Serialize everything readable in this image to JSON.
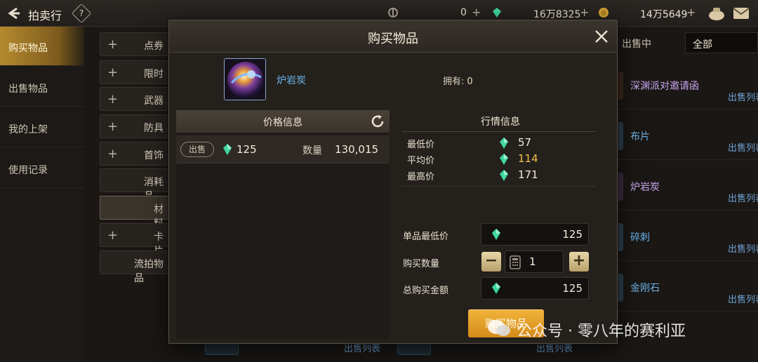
{
  "topbar": {
    "title": "拍卖行",
    "help": "?",
    "currency1": "0",
    "currency2": "16万8325",
    "currency3": "14万5649"
  },
  "sidebar": {
    "items": [
      {
        "label": "购买物品",
        "active": true
      },
      {
        "label": "出售物品",
        "active": false
      },
      {
        "label": "我的上架",
        "active": false
      },
      {
        "label": "使用记录",
        "active": false
      }
    ]
  },
  "categories": [
    {
      "label": "点券",
      "plus": true
    },
    {
      "label": "限时",
      "plus": true
    },
    {
      "label": "武器",
      "plus": true
    },
    {
      "label": "防具",
      "plus": true
    },
    {
      "label": "首饰",
      "plus": true
    },
    {
      "label": "消耗品",
      "plus": false
    },
    {
      "label": "材料",
      "plus": false
    },
    {
      "label": "卡片",
      "plus": true
    },
    {
      "label": "流拍物品",
      "plus": false
    }
  ],
  "listing": {
    "selling_header": "出售中",
    "filter": "全部",
    "rows": [
      {
        "name": "深渊派对邀请函",
        "link": "出售列表",
        "color": "#c9a6f0"
      },
      {
        "name": "布片",
        "link": "出售列表",
        "color": "#6db3ea"
      },
      {
        "name": "炉岩炭",
        "link": "出售列表",
        "color": "#c9a6f0"
      },
      {
        "name": "碎刺",
        "link": "出售列表",
        "color": "#6db3ea"
      },
      {
        "name": "金刚石",
        "link": "出售列表",
        "color": "#6db3ea"
      }
    ],
    "bottom_links": [
      "出售列表",
      "出售列表"
    ]
  },
  "modal": {
    "title": "购买物品",
    "item_name": "炉岩炭",
    "owned_label": "拥有:",
    "owned_value": "0",
    "price_info": {
      "header": "价格信息",
      "row": {
        "tag": "出售",
        "price": "125",
        "qty_label": "数量",
        "qty": "130,015"
      }
    },
    "market": {
      "title": "行情信息",
      "rows": [
        {
          "label": "最低价",
          "value": "57",
          "color": "#f2ead9"
        },
        {
          "label": "平均价",
          "value": "114",
          "color": "#f0c24a"
        },
        {
          "label": "最高价",
          "value": "171",
          "color": "#f2ead9"
        }
      ]
    },
    "form": {
      "unit_min_label": "单品最低价",
      "unit_min_value": "125",
      "qty_label": "购买数量",
      "qty_value": "1",
      "total_label": "总购买金额",
      "total_value": "125"
    },
    "buy_button": "购买物品"
  },
  "watermark": "公众号 · 零八年的赛利亚",
  "colors": {
    "accent": "#e0a22a",
    "gem": "#3fd6a0",
    "link": "#6ea2d6"
  }
}
